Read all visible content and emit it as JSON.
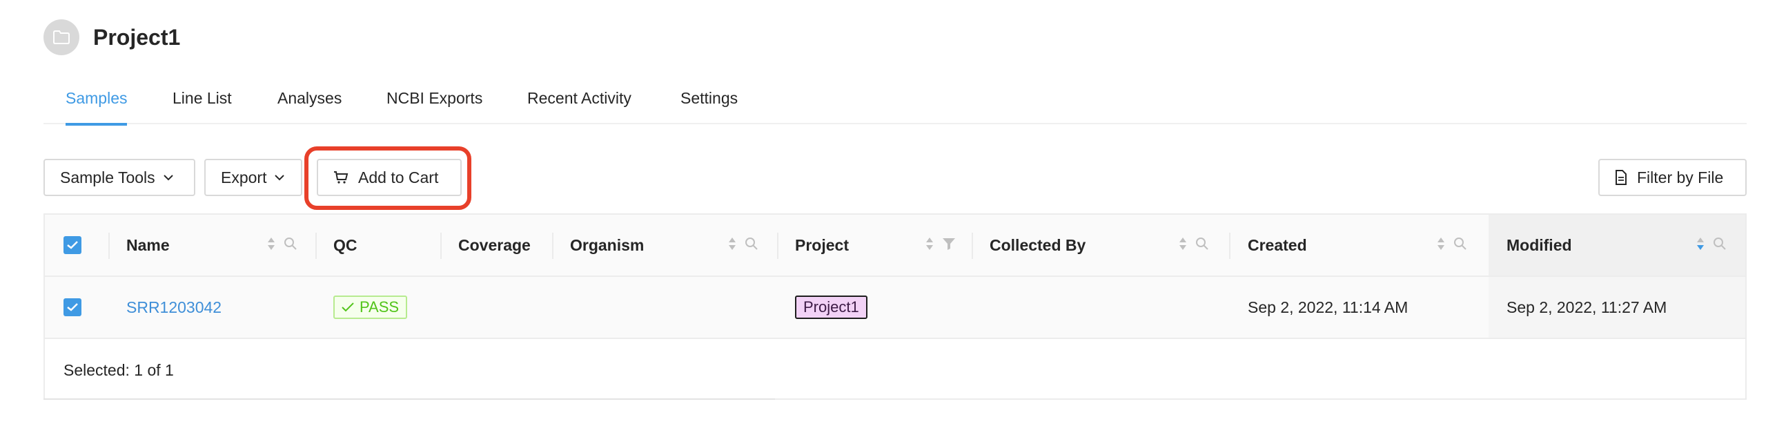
{
  "project": {
    "title": "Project1",
    "icon": "folder-icon"
  },
  "tabs": [
    {
      "label": "Samples",
      "active": true
    },
    {
      "label": "Line List",
      "active": false
    },
    {
      "label": "Analyses",
      "active": false
    },
    {
      "label": "NCBI Exports",
      "active": false
    },
    {
      "label": "Recent Activity",
      "active": false
    },
    {
      "label": "Settings",
      "active": false
    }
  ],
  "toolbar": {
    "sample_tools_label": "Sample Tools",
    "export_label": "Export",
    "add_to_cart_label": "Add to Cart",
    "filter_by_file_label": "Filter by File"
  },
  "table": {
    "columns": {
      "name": "Name",
      "qc": "QC",
      "coverage": "Coverage",
      "organism": "Organism",
      "project": "Project",
      "collected_by": "Collected By",
      "created": "Created",
      "modified": "Modified"
    },
    "rows": [
      {
        "selected": true,
        "name": "SRR1203042",
        "qc": "PASS",
        "coverage": "",
        "organism": "",
        "project": "Project1",
        "collected_by": "",
        "created": "Sep 2, 2022, 11:14 AM",
        "modified": "Sep 2, 2022, 11:27 AM"
      }
    ],
    "footer": "Selected: 1 of 1"
  },
  "colors": {
    "accent": "#3f9ae4",
    "highlight": "#e8402a",
    "pass_green": "#52c41a",
    "project_tag_bg": "#f2d2f6"
  }
}
